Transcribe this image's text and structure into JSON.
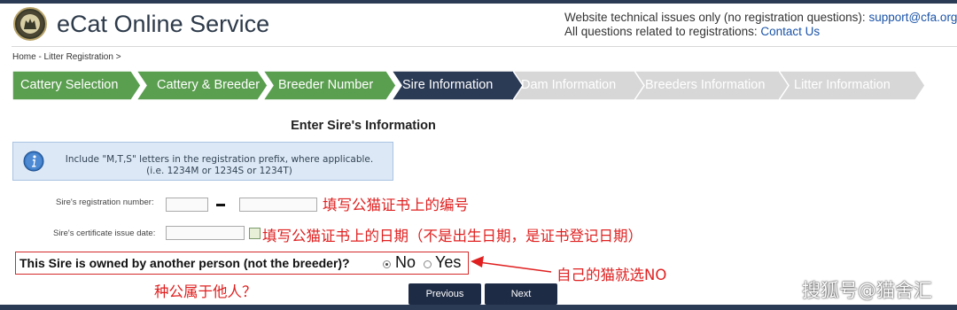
{
  "header": {
    "title": "eCat Online Service",
    "support_line1_prefix": "Website technical issues only (no registration questions):",
    "support_email": "support@cfa.org.",
    "support_line2_prefix": "All questions related to registrations:",
    "contact_link": "Contact Us"
  },
  "breadcrumb": "Home - Litter Registration >",
  "steps": [
    {
      "label": "Cattery Selection",
      "state": "done"
    },
    {
      "label": "Cattery & Breeder",
      "state": "done"
    },
    {
      "label": "Breeder Number",
      "state": "done"
    },
    {
      "label": "Sire Information",
      "state": "active"
    },
    {
      "label": "Dam Information",
      "state": "todo"
    },
    {
      "label": "Breeders Information",
      "state": "todo"
    },
    {
      "label": "Litter Information",
      "state": "todo"
    }
  ],
  "colors": {
    "done": "#5a9e4f",
    "active": "#2b3a55",
    "todo": "#d7d7d7"
  },
  "form": {
    "section_title": "Enter Sire's Information",
    "info_line1": "Include \"M,T,S\" letters in the registration prefix, where applicable.",
    "info_line2": "(i.e. 1234M or 1234S or 1234T)",
    "reg_label": "Sire's registration number:",
    "date_label": "Sire's certificate issue date:",
    "reg_prefix_value": "",
    "reg_number_value": "",
    "date_value": "",
    "owned_question": "This Sire is owned by another person (not the breeder)?",
    "opt_no": "No",
    "opt_yes": "Yes",
    "selected": "No"
  },
  "annotations": {
    "reg_note": "填写公猫证书上的编号",
    "date_note": "填写公猫证书上的日期（不是出生日期，是证书登记日期）",
    "choose_no_note": "自己的猫就选NO",
    "owned_note": "种公属于他人？"
  },
  "buttons": {
    "previous": "Previous",
    "next": "Next"
  },
  "watermark": "搜狐号@猫舍汇"
}
